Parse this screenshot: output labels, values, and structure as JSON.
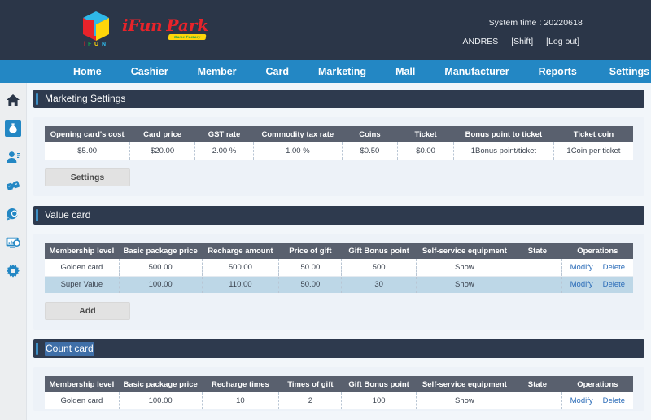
{
  "header": {
    "brand_primary": "iFun",
    "brand_secondary": "Park",
    "brand_tagline": "Game Factory",
    "logo_caption": "iFUN",
    "system_time_label": "System time : 20220618",
    "user_name": "ANDRES",
    "shift_label": "[Shift]",
    "logout_label": "[Log out]"
  },
  "nav": {
    "items": [
      {
        "label": "Home"
      },
      {
        "label": "Cashier"
      },
      {
        "label": "Member"
      },
      {
        "label": "Card"
      },
      {
        "label": "Marketing"
      },
      {
        "label": "Mall"
      },
      {
        "label": "Manufacturer"
      },
      {
        "label": "Reports"
      },
      {
        "label": "Settings"
      }
    ]
  },
  "sidebar": {
    "items": [
      {
        "icon": "home-icon",
        "active": false
      },
      {
        "icon": "money-bag-icon",
        "active": true
      },
      {
        "icon": "member-icon",
        "active": false
      },
      {
        "icon": "ticket-icon",
        "active": false
      },
      {
        "icon": "coin-icon",
        "active": false
      },
      {
        "icon": "monitor-report-icon",
        "active": false
      },
      {
        "icon": "gear-icon",
        "active": false
      }
    ]
  },
  "sections": {
    "marketing_settings": {
      "title": "Marketing Settings",
      "columns": [
        "Opening card's cost",
        "Card price",
        "GST rate",
        "Commodity tax rate",
        "Coins",
        "Ticket",
        "Bonus point to ticket",
        "Ticket coin"
      ],
      "rows": [
        [
          "$5.00",
          "$20.00",
          "2.00 %",
          "1.00 %",
          "$0.50",
          "$0.00",
          "1Bonus point/ticket",
          "1Coin per ticket"
        ]
      ],
      "button_label": "Settings"
    },
    "value_card": {
      "title": "Value card",
      "columns": [
        "Membership level",
        "Basic package price",
        "Recharge amount",
        "Price of gift",
        "Gift Bonus point",
        "Self-service equipment",
        "State",
        "Operations"
      ],
      "rows": [
        {
          "cells": [
            "Golden card",
            "500.00",
            "500.00",
            "50.00",
            "500",
            "Show",
            ""
          ],
          "modify": "Modify",
          "delete": "Delete"
        },
        {
          "cells": [
            "Super Value",
            "100.00",
            "110.00",
            "50.00",
            "30",
            "Show",
            ""
          ],
          "modify": "Modify",
          "delete": "Delete"
        }
      ],
      "button_label": "Add"
    },
    "count_card": {
      "title": "Count card",
      "columns": [
        "Membership level",
        "Basic package price",
        "Recharge times",
        "Times of gift",
        "Gift Bonus point",
        "Self-service equipment",
        "State",
        "Operations"
      ],
      "rows": [
        {
          "cells": [
            "Golden card",
            "100.00",
            "10",
            "2",
            "100",
            "Show",
            ""
          ],
          "modify": "Modify",
          "delete": "Delete"
        }
      ]
    }
  },
  "colors": {
    "header_bg": "#2b3648",
    "nav_bg": "#2387c4",
    "section_bg": "#2e3a4e",
    "accent": "#3e8fc4",
    "table_head": "#59606e",
    "row_alt": "#bdd7e7",
    "link": "#2b6cb8"
  }
}
